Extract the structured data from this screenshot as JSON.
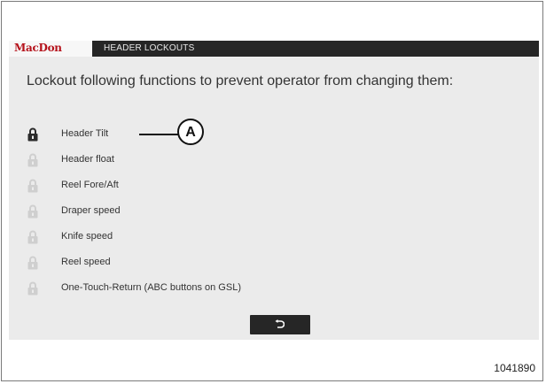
{
  "header": {
    "brand": "MacDon",
    "title": "HEADER LOCKOUTS"
  },
  "prompt": "Lockout following functions to prevent operator from changing them:",
  "lockouts": [
    {
      "label": "Header Tilt",
      "locked": true
    },
    {
      "label": "Header float",
      "locked": false
    },
    {
      "label": "Reel Fore/Aft",
      "locked": false
    },
    {
      "label": "Draper speed",
      "locked": false
    },
    {
      "label": "Knife speed",
      "locked": false
    },
    {
      "label": "Reel speed",
      "locked": false
    },
    {
      "label": "One-Touch-Return (ABC buttons on GSL)",
      "locked": false
    }
  ],
  "callout": {
    "label": "A"
  },
  "back_button": {
    "icon": "back-arrow-icon"
  },
  "figure_number": "1041890",
  "colors": {
    "brand_red": "#b5121b",
    "bar_dark": "#262626",
    "screen_bg": "#ebebeb",
    "lock_active": "#2b2b2b",
    "lock_inactive": "#cfcfcf"
  }
}
